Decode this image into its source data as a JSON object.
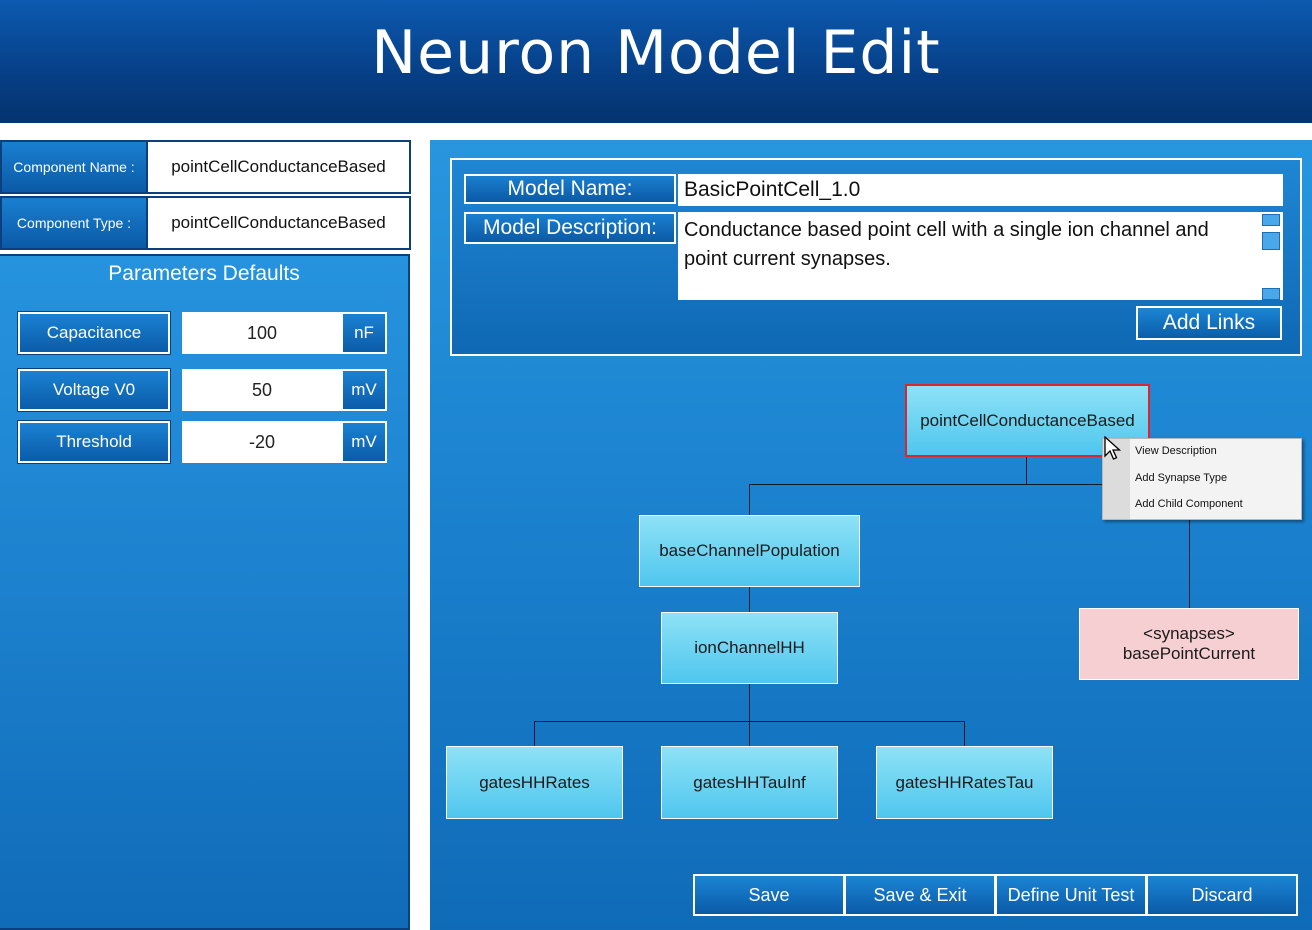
{
  "header": {
    "title": "Neuron Model Edit"
  },
  "component": {
    "name_label": "Component Name :",
    "name_value": "pointCellConductanceBased",
    "type_label": "Component Type :",
    "type_value": "pointCellConductanceBased"
  },
  "parameters": {
    "title": "Parameters Defaults",
    "items": [
      {
        "label": "Capacitance",
        "value": "100",
        "unit": "nF"
      },
      {
        "label": "Voltage V0",
        "value": "50",
        "unit": "mV"
      },
      {
        "label": "Threshold",
        "value": "-20",
        "unit": "mV"
      }
    ]
  },
  "model": {
    "name_label": "Model Name:",
    "name_value": "BasicPointCell_1.0",
    "description_label": "Model Description:",
    "description_value": "Conductance based point cell with a single ion channel and point current synapses.",
    "add_links_label": "Add Links"
  },
  "tree": {
    "root": "pointCellConductanceBased",
    "base_channel": "baseChannelPopulation",
    "ion_channel": "ionChannelHH",
    "gate1": "gatesHHRates",
    "gate2": "gatesHHTauInf",
    "gate3": "gatesHHRatesTau",
    "synapses_tag": "<synapses>",
    "synapses_name": "basePointCurrent"
  },
  "context_menu": {
    "items": [
      "View Description",
      "Add Synapse Type",
      "Add Child Component"
    ]
  },
  "actions": {
    "save": "Save",
    "save_exit": "Save & Exit",
    "define_unit_test": "Define Unit Test",
    "discard": "Discard"
  },
  "colors": {
    "header": "#063f86",
    "panel": "#1a80cd",
    "node": "#4fc6ee",
    "synapse_node": "#f5cfd2",
    "selected_border": "#e0242c"
  }
}
